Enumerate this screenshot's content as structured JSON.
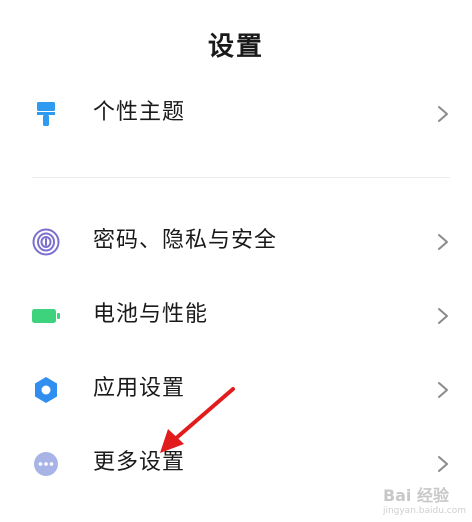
{
  "header": {
    "title": "设置"
  },
  "settings": {
    "items": [
      {
        "label": "个性主题",
        "icon": "paint-brush-icon",
        "color": "#2f9bf0"
      },
      {
        "label": "密码、隐私与安全",
        "icon": "fingerprint-icon",
        "color": "#7b6fcf"
      },
      {
        "label": "电池与性能",
        "icon": "battery-icon",
        "color": "#3dd27c"
      },
      {
        "label": "应用设置",
        "icon": "gear-icon",
        "color": "#2f8ef0"
      },
      {
        "label": "更多设置",
        "icon": "more-dots-icon",
        "color": "#a9b4e6"
      }
    ]
  },
  "watermark": {
    "text": "Bai 经验",
    "subtext": "jingyan.baidu.com"
  },
  "colors": {
    "annotation_arrow": "#e21c1c",
    "chevron": "#8a8a8a"
  }
}
